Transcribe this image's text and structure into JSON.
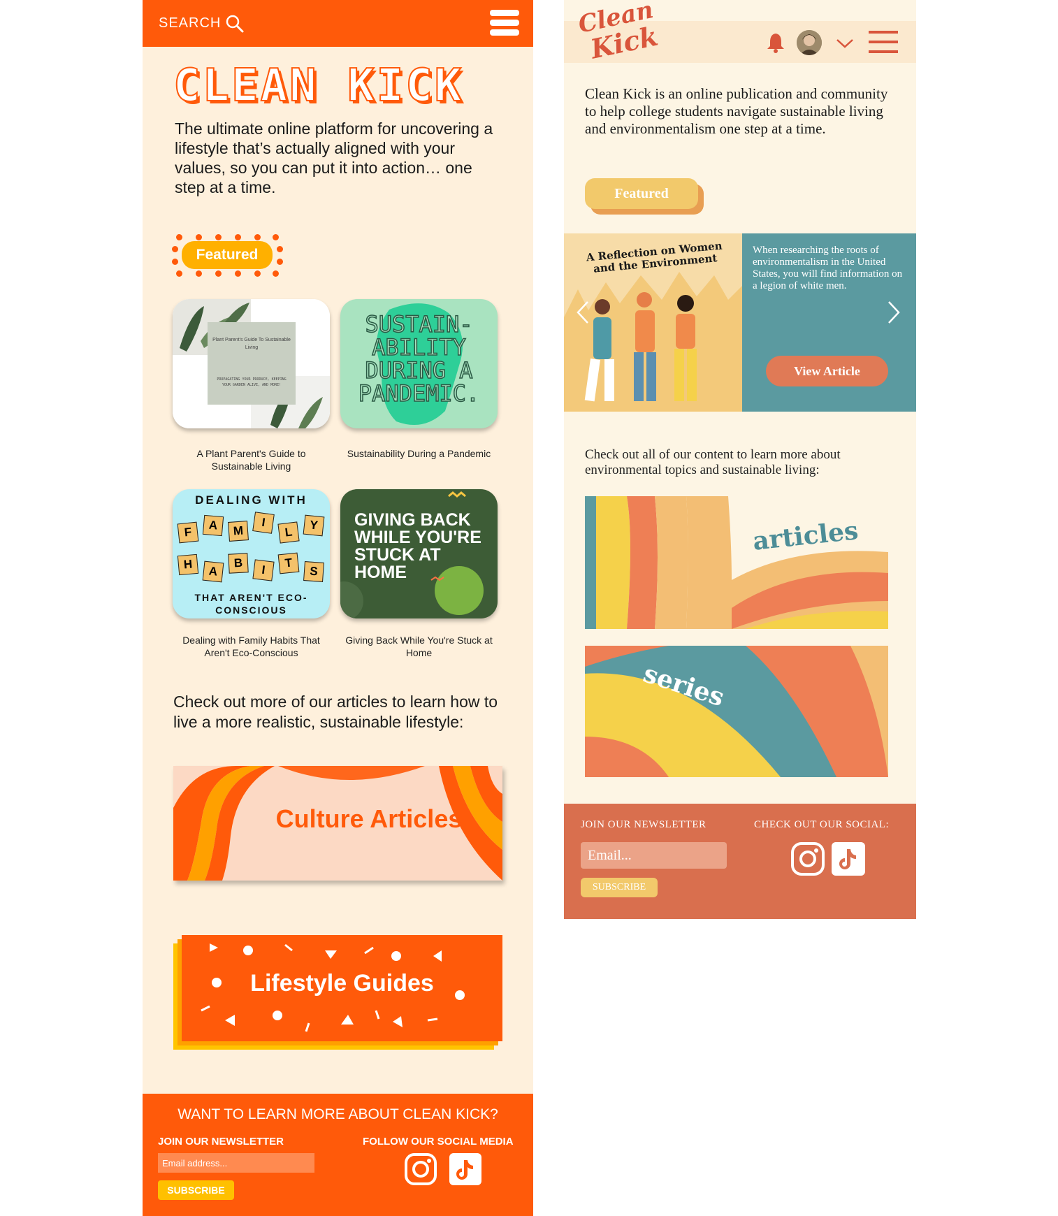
{
  "left": {
    "search_label": "SEARCH",
    "brand_title": "CLEAN KICK",
    "tagline": "The ultimate online platform for uncovering a lifestyle that’s actually aligned with your values, so you can put it into action… one step at a time.",
    "featured_label": "Featured",
    "cards": [
      {
        "caption": "A Plant Parent's Guide to Sustainable Living",
        "thumb_title": "Plant Parent's Guide To Sustainable Living",
        "thumb_sub": "PROPAGATING YOUR PRODUCE, KEEPING YOUR GARDEN ALIVE, AND MORE!"
      },
      {
        "caption": "Sustainability During a Pandemic",
        "thumb_lines": [
          "SUSTAIN-",
          "ABILITY",
          "DURING A",
          "PANDEMIC."
        ]
      },
      {
        "caption": "Dealing with Family Habits That Aren't Eco-Conscious",
        "thumb_top": "DEALING WITH",
        "tiles_row1": [
          "F",
          "A",
          "M",
          "I",
          "L",
          "Y"
        ],
        "tiles_row2": [
          "H",
          "A",
          "B",
          "I",
          "T",
          "S"
        ],
        "thumb_bottom": "THAT AREN'T ECO-CONSCIOUS"
      },
      {
        "caption": "Giving Back While You're Stuck at Home",
        "thumb_lines": [
          "GIVING BACK",
          "WHILE YOU'RE",
          "STUCK AT",
          "HOME"
        ]
      }
    ],
    "blurb": "Check out more of our articles to learn how to live a more realistic, sustainable lifestyle:",
    "culture_label": "Culture Articles",
    "lifestyle_label": "Lifestyle Guides",
    "footer": {
      "question": "WANT TO LEARN MORE ABOUT CLEAN KICK?",
      "newsletter_label": "JOIN OUR NEWSLETTER",
      "social_label": "FOLLOW OUR SOCIAL MEDIA",
      "email_placeholder": "Email address...",
      "subscribe_label": "SUBSCRIBE"
    }
  },
  "right": {
    "logo_lines": [
      "Clean",
      "Kick"
    ],
    "intro": "Clean Kick is an online publication and community to help college students navigate sustainable living and environmentalism one step at a time.",
    "featured_label": "Featured",
    "hero": {
      "image_title": "A Reflection on Women and the Environment",
      "description": "When researching the roots of environmentalism in the United States, you will find information on a legion of white men.",
      "view_label": "View Article"
    },
    "blurb": "Check out all of our content to learn more about environmental topics and sustainable living:",
    "articles_label": "articles",
    "series_label": "series",
    "footer": {
      "newsletter_label": "JOIN OUR NEWSLETTER",
      "social_label": "CHECK OUT OUR SOCIAL:",
      "email_placeholder": "Email...",
      "subscribe_label": "SUBSCRIBE"
    }
  },
  "colors": {
    "left_orange": "#ff5a0a",
    "left_cream": "#fef0dc",
    "left_yellow": "#ffb000",
    "right_cream": "#fdf5e4",
    "right_teal": "#5b9aa0",
    "right_coral": "#d96f4e",
    "right_yellow": "#f2c96b"
  },
  "icons": [
    "search-icon",
    "menu-icon",
    "bell-icon",
    "avatar",
    "chevron-down-icon",
    "chevron-left-icon",
    "chevron-right-icon",
    "instagram-icon",
    "tiktok-icon"
  ]
}
